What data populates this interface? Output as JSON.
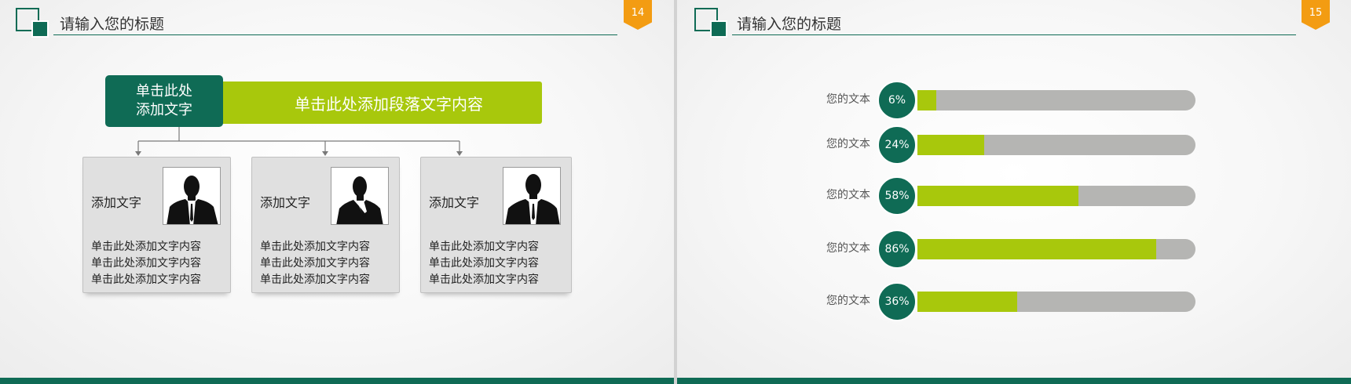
{
  "slide14": {
    "title": "请输入您的标题",
    "page_number": "14",
    "head_box": {
      "line1": "单击此处",
      "line2": "添加文字"
    },
    "banner_text": "单击此处添加段落文字内容",
    "cards": [
      {
        "label": "添加文字",
        "lines": [
          "单击此处添加文字内容",
          "单击此处添加文字内容",
          "单击此处添加文字内容"
        ],
        "photo": "person-silhouette-icon"
      },
      {
        "label": "添加文字",
        "lines": [
          "单击此处添加文字内容",
          "单击此处添加文字内容",
          "单击此处添加文字内容"
        ],
        "photo": "person-silhouette-icon"
      },
      {
        "label": "添加文字",
        "lines": [
          "单击此处添加文字内容",
          "单击此处添加文字内容",
          "单击此处添加文字内容"
        ],
        "photo": "person-silhouette-icon"
      }
    ]
  },
  "slide15": {
    "title": "请输入您的标题",
    "page_number": "15",
    "bars": [
      {
        "label": "您的文本",
        "percent_text": "6%",
        "value": 6
      },
      {
        "label": "您的文本",
        "percent_text": "24%",
        "value": 24
      },
      {
        "label": "您的文本",
        "percent_text": "58%",
        "value": 58
      },
      {
        "label": "您的文本",
        "percent_text": "86%",
        "value": 86
      },
      {
        "label": "您的文本",
        "percent_text": "36%",
        "value": 36
      }
    ]
  },
  "colors": {
    "primary_green": "#0f6b55",
    "accent_lime": "#a8c80c",
    "badge_orange": "#f39c12",
    "track_gray": "#b5b5b3",
    "card_gray": "#e0e0e0"
  }
}
